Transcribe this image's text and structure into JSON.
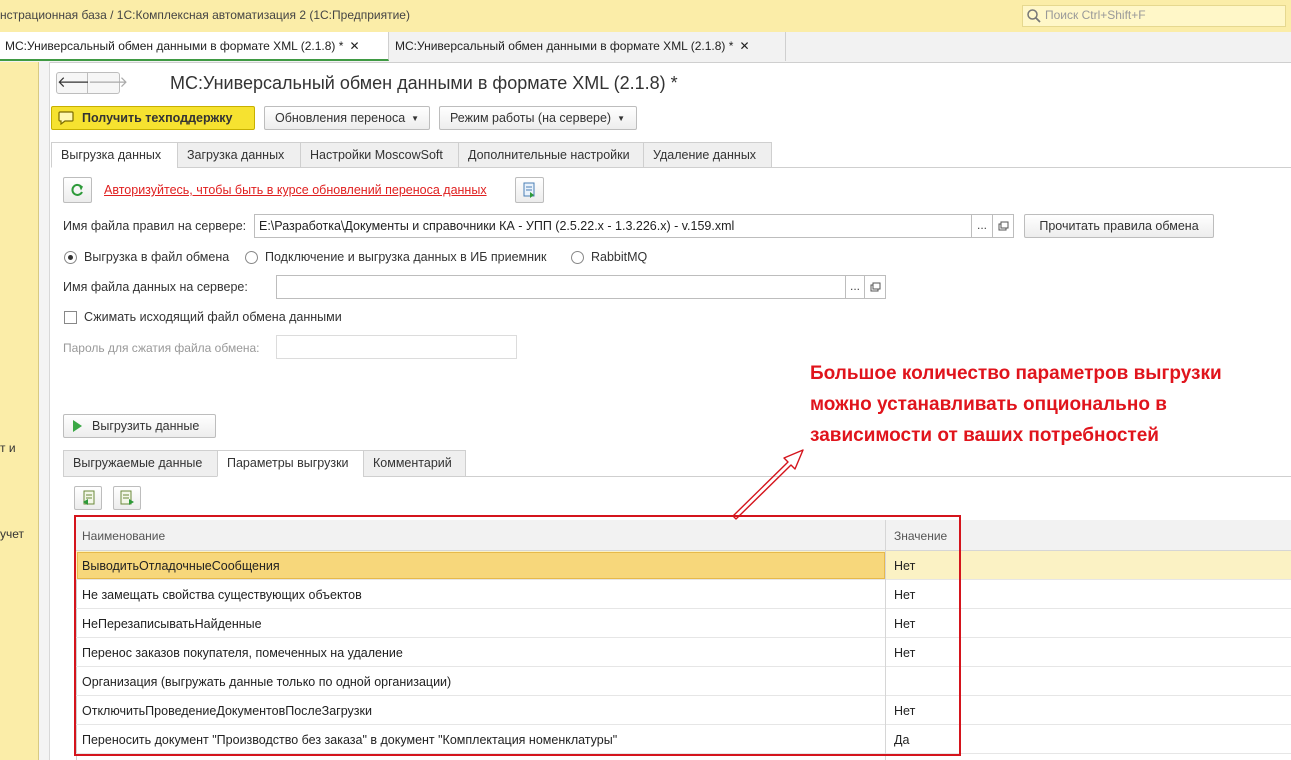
{
  "window": {
    "title": "нстрационная база / 1С:Комплексная автоматизация 2  (1С:Предприятие)",
    "search_placeholder": "Поиск Ctrl+Shift+F"
  },
  "window_tabs": [
    {
      "label": "МС:Универсальный обмен данными в формате XML (2.1.8) *",
      "close": "✕",
      "active": true
    },
    {
      "label": "МС:Универсальный обмен данными в формате XML (2.1.8) *",
      "close": "✕",
      "active": false
    }
  ],
  "left_panel": {
    "fragment1": "т и",
    "fragment2": "учет"
  },
  "nav": {
    "back": "🡐",
    "forward": "🡒"
  },
  "page_title": "МС:Универсальный обмен данными в формате XML (2.1.8) *",
  "toolbar": {
    "support": "Получить техподдержку",
    "updates": "Обновления переноса",
    "mode": "Режим работы (на сервере)",
    "caret": "▼"
  },
  "main_tabs": [
    {
      "label": "Выгрузка данных",
      "active": true
    },
    {
      "label": "Загрузка данных",
      "active": false
    },
    {
      "label": "Настройки MoscowSoft",
      "active": false
    },
    {
      "label": "Дополнительные настройки",
      "active": false
    },
    {
      "label": "Удаление данных",
      "active": false
    }
  ],
  "auth_link": "Авторизуйтесь, чтобы быть в курсе обновлений переноса данных",
  "rules_file": {
    "label": "Имя файла правил на сервере:",
    "value": "E:\\Разработка\\Документы и справочники КА - УПП (2.5.22.x - 1.3.226.x) - v.159.xml",
    "dots": "...",
    "read_button": "Прочитать правила обмена"
  },
  "radios": [
    {
      "label": "Выгрузка в файл обмена",
      "checked": true
    },
    {
      "label": "Подключение и выгрузка данных в ИБ приемник",
      "checked": false
    },
    {
      "label": "RabbitMQ",
      "checked": false
    }
  ],
  "data_file": {
    "label": "Имя файла данных на сервере:",
    "value": "",
    "dots": "..."
  },
  "compress": {
    "label": "Сжимать исходящий файл обмена данными",
    "checked": false
  },
  "password": {
    "label": "Пароль для сжатия файла обмена:",
    "value": ""
  },
  "export_button": "Выгрузить данные",
  "sub_tabs": [
    {
      "label": "Выгружаемые данные",
      "active": false
    },
    {
      "label": "Параметры выгрузки",
      "active": true
    },
    {
      "label": "Комментарий",
      "active": false
    }
  ],
  "table": {
    "columns": [
      "Наименование",
      "Значение"
    ],
    "rows": [
      {
        "name": "ВыводитьОтладочныеСообщения",
        "value": "Нет",
        "selected": true
      },
      {
        "name": "Не замещать свойства существующих объектов",
        "value": "Нет"
      },
      {
        "name": "НеПерезаписыватьНайденные",
        "value": "Нет"
      },
      {
        "name": "Перенос заказов покупателя, помеченных на удаление",
        "value": "Нет"
      },
      {
        "name": "Организация (выгружать данные только по одной организации)",
        "value": ""
      },
      {
        "name": "ОтключитьПроведениеДокументовПослеЗагрузки",
        "value": "Нет"
      },
      {
        "name": "Переносить документ \"Производство без заказа\" в документ \"Комплектация номенклатуры\"",
        "value": "Да"
      }
    ]
  },
  "annotation": {
    "lines": [
      "Большое количество параметров выгрузки",
      "можно устанавливать опционально в",
      "зависимости от ваших потребностей"
    ]
  },
  "colors": {
    "accent_yellow": "#f6e230",
    "panel_yellow": "#fbeda8",
    "annotation_red": "#e0141c",
    "tab_green": "#3f9a43"
  }
}
